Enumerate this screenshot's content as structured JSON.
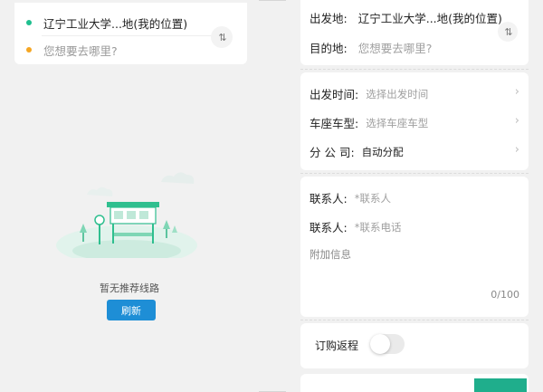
{
  "left": {
    "from": "辽宁工业大学...地(我的位置)",
    "to_placeholder": "您想要去哪里?",
    "swap_icon": "⇅",
    "empty_text": "暂无推荐线路",
    "refresh_label": "刷新"
  },
  "right": {
    "depart_label": "出发地:",
    "depart_value": "辽宁工业大学...地(我的位置)",
    "dest_label": "目的地:",
    "dest_placeholder": "您想要去哪里?",
    "swap_icon": "⇅",
    "time_label": "出发时间:",
    "time_placeholder": "选择出发时间",
    "seat_label": "车座车型:",
    "seat_placeholder": "选择车座车型",
    "branch_label": "分 公 司:",
    "branch_value": "自动分配",
    "chevron": "›",
    "contact1_label": "联系人:",
    "contact1_placeholder": "*联系人",
    "contact2_label": "联系人:",
    "contact2_placeholder": "*联系电话",
    "extra_placeholder": "附加信息",
    "counter": "0/100",
    "return_label": "订购返程",
    "return_toggle_on": false
  },
  "colors": {
    "accent_green": "#1fbf8f",
    "accent_orange": "#f5a623",
    "button_blue": "#1e8ed6"
  }
}
